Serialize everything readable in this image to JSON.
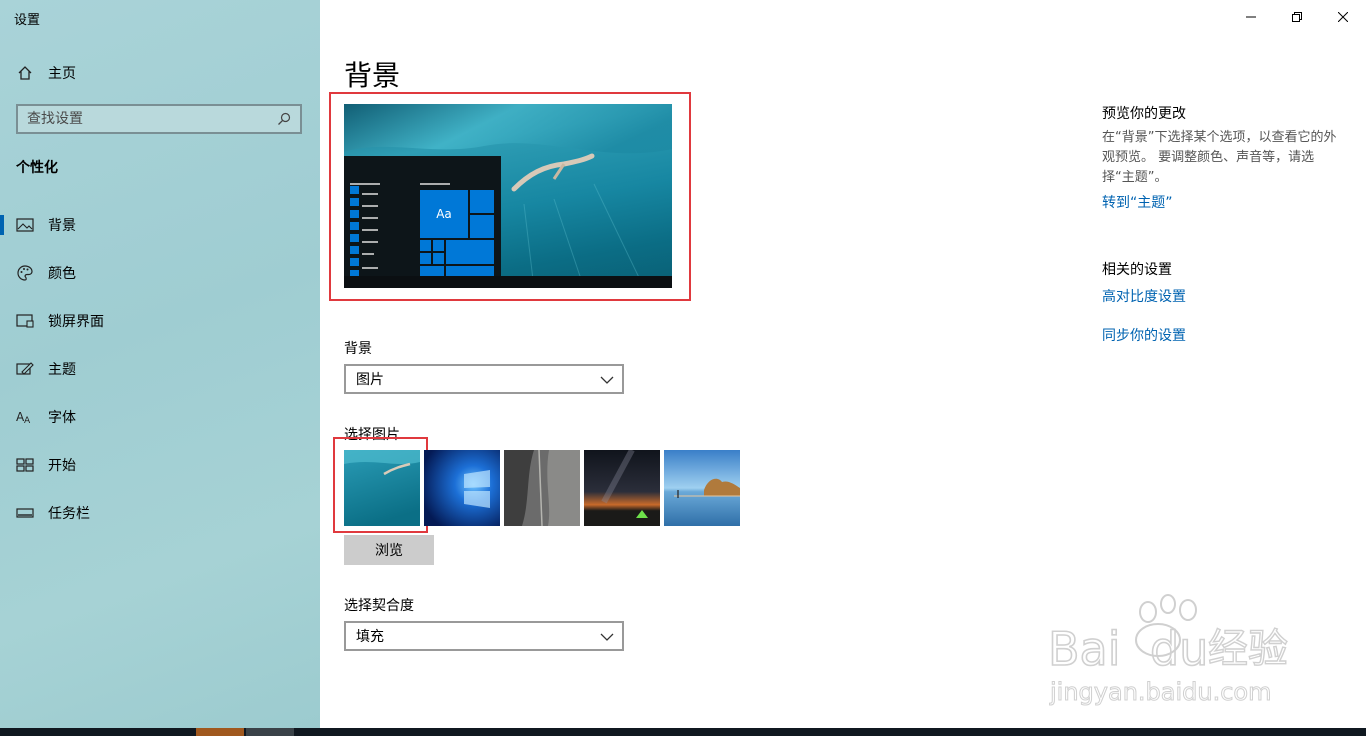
{
  "window": {
    "title": "设置",
    "controls": {
      "minimize": "minimize-icon",
      "maximize": "restore-icon",
      "close": "close-icon"
    }
  },
  "sidebar": {
    "home_label": "主页",
    "search_placeholder": "查找设置",
    "section": "个性化",
    "items": [
      {
        "label": "背景",
        "icon": "picture-icon",
        "active": true
      },
      {
        "label": "颜色",
        "icon": "palette-icon",
        "active": false
      },
      {
        "label": "锁屏界面",
        "icon": "lockscreen-icon",
        "active": false
      },
      {
        "label": "主题",
        "icon": "theme-icon",
        "active": false
      },
      {
        "label": "字体",
        "icon": "font-icon",
        "active": false
      },
      {
        "label": "开始",
        "icon": "start-icon",
        "active": false
      },
      {
        "label": "任务栏",
        "icon": "taskbar-icon",
        "active": false
      }
    ]
  },
  "main": {
    "title": "背景",
    "preview": {
      "tile_label": "Aa"
    },
    "background_label": "背景",
    "background_value": "图片",
    "choose_picture_label": "选择图片",
    "browse_label": "浏览",
    "fit_label": "选择契合度",
    "fit_value": "填充"
  },
  "right_panel": {
    "preview_heading": "预览你的更改",
    "preview_desc": "在“背景”下选择某个选项，以查看它的外观预览。 要调整颜色、声音等，请选择“主题”。",
    "goto_themes_link": "转到“主题”",
    "related_heading": "相关的设置",
    "high_contrast_link": "高对比度设置",
    "sync_link": "同步你的设置"
  },
  "colors": {
    "accent": "#0063b1",
    "highlight": "#e0393e",
    "link": "#0063b1"
  }
}
